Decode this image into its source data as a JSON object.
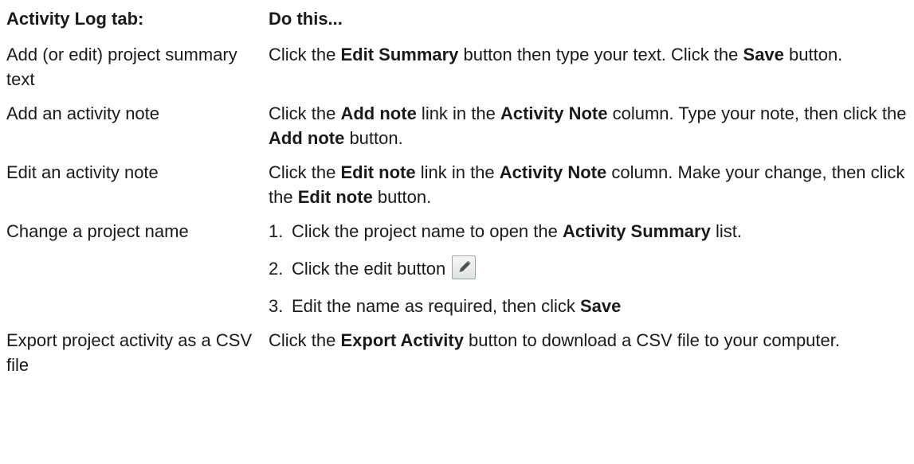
{
  "header": {
    "left": "Activity Log tab:",
    "right": "Do this..."
  },
  "rows": [
    {
      "task": "Add (or edit) project summary text",
      "parts": [
        "Click the ",
        "Edit Summary",
        " button then type your text. Click the ",
        "Save",
        " button."
      ]
    },
    {
      "task": "Add an activity note",
      "parts": [
        "Click the ",
        "Add note",
        " link in the ",
        "Activity Note",
        " column.  Type your note, then click the ",
        "Add note",
        " button."
      ]
    },
    {
      "task": "Edit an activity note",
      "parts": [
        "Click the ",
        "Edit note",
        " link in the ",
        "Activity Note",
        " column.  Make your change, then click the ",
        "Edit note",
        " button."
      ]
    },
    {
      "task": "Change a project name",
      "steps": [
        {
          "num": "1.",
          "parts": [
            "Click the project name to open the ",
            "Activity Summary",
            " list."
          ]
        },
        {
          "num": "2.",
          "parts": [
            "Click the edit button "
          ]
        },
        {
          "num": "3.",
          "parts": [
            "Edit the name as required, then click ",
            "Save"
          ]
        }
      ]
    },
    {
      "task": "Export project activity as a CSV file",
      "parts": [
        "Click the ",
        "Export Activity",
        " button to download a CSV file to your computer."
      ]
    }
  ],
  "icons": {
    "edit": "pencil-icon"
  }
}
